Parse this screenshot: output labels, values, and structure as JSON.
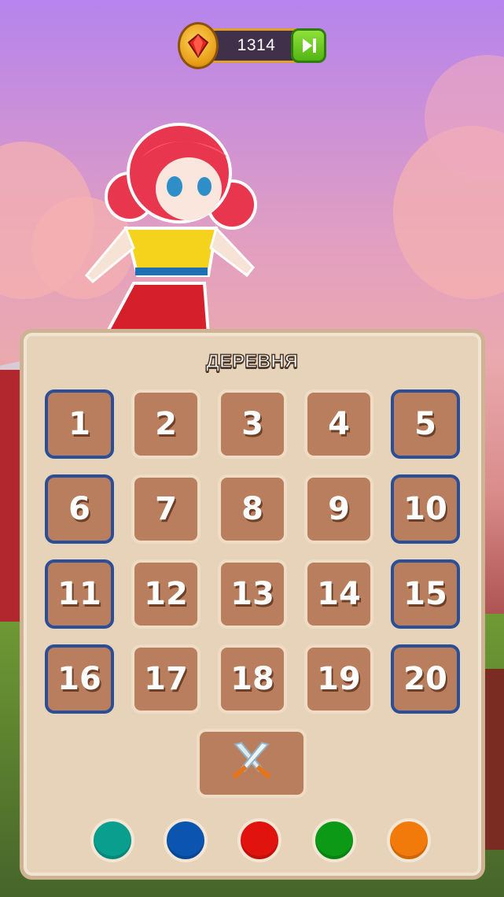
{
  "currency": {
    "amount": "1314",
    "icon": "ruby-coin-icon"
  },
  "skip_icon": "skip-forward-icon",
  "level_panel": {
    "title": "ДЕРЕВНЯ",
    "levels": [
      {
        "label": "1",
        "highlighted": true
      },
      {
        "label": "2",
        "highlighted": false
      },
      {
        "label": "3",
        "highlighted": false
      },
      {
        "label": "4",
        "highlighted": false
      },
      {
        "label": "5",
        "highlighted": true
      },
      {
        "label": "6",
        "highlighted": true
      },
      {
        "label": "7",
        "highlighted": false
      },
      {
        "label": "8",
        "highlighted": false
      },
      {
        "label": "9",
        "highlighted": false
      },
      {
        "label": "10",
        "highlighted": true
      },
      {
        "label": "11",
        "highlighted": true
      },
      {
        "label": "12",
        "highlighted": false
      },
      {
        "label": "13",
        "highlighted": false
      },
      {
        "label": "14",
        "highlighted": false
      },
      {
        "label": "15",
        "highlighted": true
      },
      {
        "label": "16",
        "highlighted": true
      },
      {
        "label": "17",
        "highlighted": false
      },
      {
        "label": "18",
        "highlighted": false
      },
      {
        "label": "19",
        "highlighted": false
      },
      {
        "label": "20",
        "highlighted": true
      }
    ],
    "battle_icon": "crossed-swords-icon"
  },
  "color_options": [
    {
      "name": "teal",
      "color": "#0a9e8e"
    },
    {
      "name": "blue",
      "color": "#0b54b0"
    },
    {
      "name": "red",
      "color": "#e0130f"
    },
    {
      "name": "green",
      "color": "#0c9a16"
    },
    {
      "name": "orange",
      "color": "#f27a0a"
    }
  ],
  "colors": {
    "panel": "#e7d3b9",
    "tile": "#b87e5e",
    "highlight_border": "#2a4e97"
  }
}
